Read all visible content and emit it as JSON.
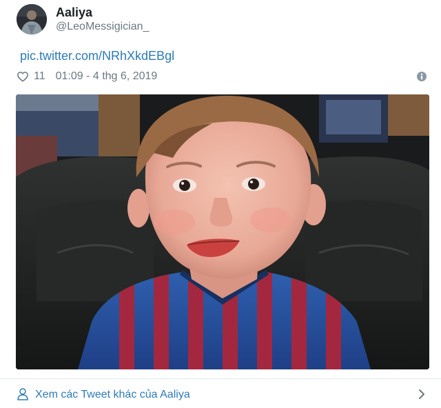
{
  "author": {
    "display_name": "Aaliya",
    "handle": "@LeoMessigician_"
  },
  "tweet": {
    "link_text": "pic.twitter.com/NRhXkdEBgl",
    "like_count": "11",
    "timestamp": "01:09 - 4 thg 6, 2019"
  },
  "footer": {
    "more_tweets_label": "Xem các Tweet khác của Aaliya"
  },
  "icons": {
    "like": "heart-icon",
    "info": "info-icon",
    "profile": "person-icon",
    "next": "chevron-right-icon"
  },
  "colors": {
    "link": "#2b7bb9",
    "secondary_text": "#697882",
    "primary_text": "#1c2022",
    "divider": "#e1e8ed"
  }
}
